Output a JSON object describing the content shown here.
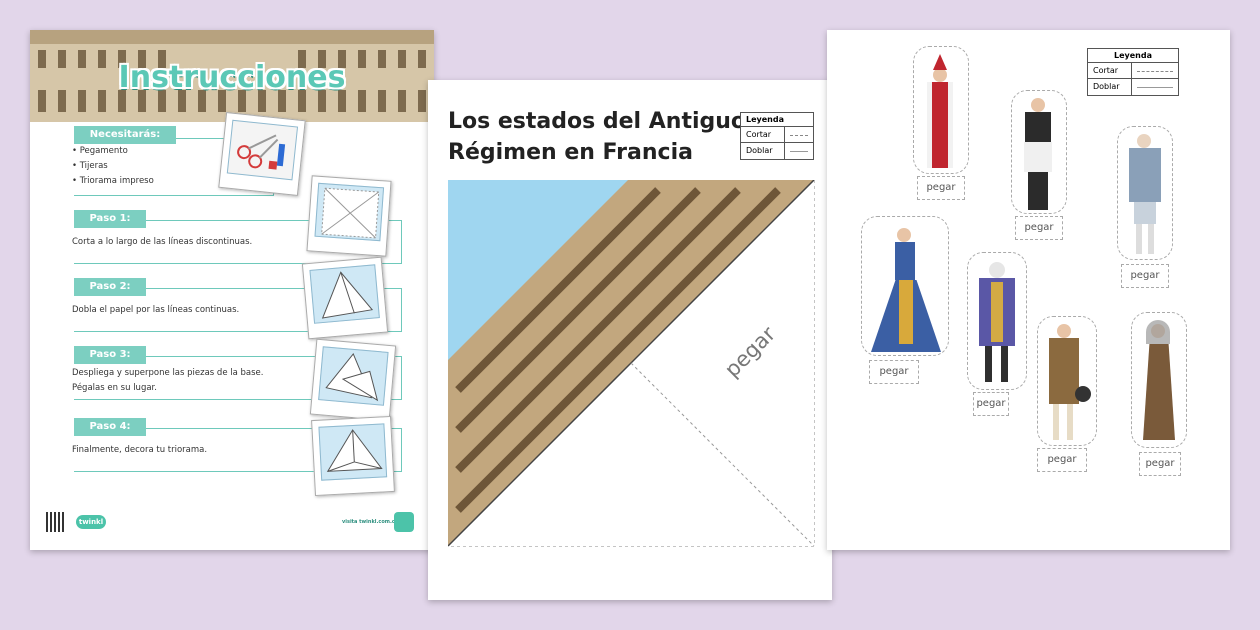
{
  "instructions": {
    "title": "Instrucciones",
    "needs_label": "Necesitarás:",
    "needs_items": [
      "• Pegamento",
      "• Tijeras",
      "• Triorama impreso"
    ],
    "steps": [
      {
        "label": "Paso 1:",
        "text": "Corta a lo largo de las líneas discontinuas."
      },
      {
        "label": "Paso 2:",
        "text": "Dobla el papel por las líneas continuas."
      },
      {
        "label": "Paso 3:",
        "text_lines": [
          "Despliega y superpone las piezas de la base.",
          "Pégalas en su lugar."
        ]
      },
      {
        "label": "Paso 4:",
        "text": "Finalmente, decora tu triorama."
      }
    ],
    "footer": {
      "logo": "twinkl",
      "url": "visita twinkl.com.co"
    }
  },
  "triorama_sheet": {
    "title_lines": [
      "Los estados del Antiguo",
      "Régimen en Francia"
    ],
    "legend": {
      "title": "Leyenda",
      "rows": [
        "Cortar",
        "Doblar"
      ]
    },
    "pegar": "pegar"
  },
  "figures_sheet": {
    "legend": {
      "title": "Leyenda",
      "rows": [
        "Cortar",
        "Doblar"
      ]
    },
    "figure_labels": [
      "pegar",
      "pegar",
      "pegar",
      "pegar",
      "pegar",
      "pegar",
      "pegar"
    ]
  },
  "colors": {
    "background": "#e2d6ea",
    "accent": "#7ccfc1",
    "sky": "#9fd6f0"
  },
  "icons": [
    "scissors-icon",
    "glue-icon",
    "qr-code-icon",
    "twinkl-logo-icon"
  ]
}
